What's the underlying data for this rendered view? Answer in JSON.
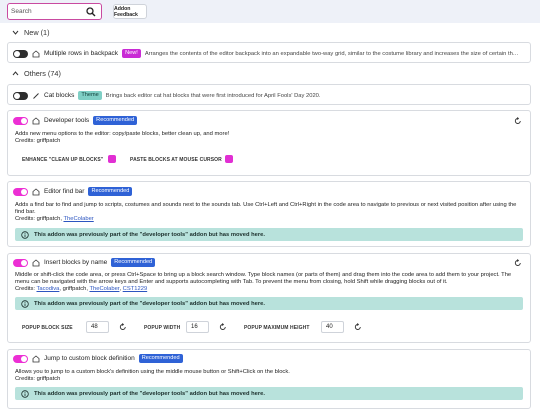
{
  "toolbar": {
    "search_placeholder": "Search",
    "feedback_label": "Addon Feedback"
  },
  "sections": {
    "new_label": "New (1)",
    "others_label": "Others (74)"
  },
  "addons": {
    "backpack": {
      "name": "Multiple rows in backpack",
      "tag": "New!",
      "description": "Arranges the contents of the editor backpack into an expandable two-way grid, similar to the costume library and increases the size of certain thu..."
    },
    "cat_blocks": {
      "name": "Cat blocks",
      "tag": "Theme",
      "description": "Brings back editor cat hat blocks that were first introduced for April Fools' Day 2020."
    },
    "developer_tools": {
      "name": "Developer tools",
      "tag": "Recommended",
      "description": "Adds new menu options to the editor: copy/paste blocks, better clean up, and more!",
      "credits": "Credits: griffpatch",
      "setting1": "ENHANCE \"CLEAN UP BLOCKS\"",
      "setting2": "PASTE BLOCKS AT MOUSE CURSOR"
    },
    "find_bar": {
      "name": "Editor find bar",
      "tag": "Recommended",
      "description": "Adds a find bar to find and jump to scripts, costumes and sounds next to the sounds tab. Use Ctrl+Left and Ctrl+Right in the code area to navigate to previous or next visited position after using the find bar.",
      "credits_prefix": "Credits: griffpatch, ",
      "credit_link": "TheColaber",
      "notice": "This addon was previously part of the \"developer tools\" addon but has moved here."
    },
    "insert_blocks": {
      "name": "Insert blocks by name",
      "tag": "Recommended",
      "description": "Middle or shift-click the code area, or press Ctrl+Space to bring up a block search window. Type block names (or parts of them) and drag them into the code area to add them to your project. The menu can be navigated with the arrow keys and Enter and supports autocompleting with Tab. To prevent the menu from closing, hold Shift while dragging blocks out of it.",
      "credits_prefix": "Credits: ",
      "credit_link1": "Tacodiva",
      "credits_mid": ", griffpatch, ",
      "credit_link2": "TheColaber",
      "credit_sep": ", ",
      "credit_link3": "CST1229",
      "notice": "This addon was previously part of the \"developer tools\" addon but has moved here.",
      "size_label": "POPUP BLOCK SIZE",
      "size_value": "48",
      "width_label": "POPUP WIDTH",
      "width_value": "16",
      "height_label": "POPUP MAXIMUM HEIGHT",
      "height_value": "40"
    },
    "jump_def": {
      "name": "Jump to custom block definition",
      "tag": "Recommended",
      "description": "Allows you to jump to a custom block's definition using the middle mouse button or Shift+Click on the block.",
      "credits": "Credits: griffpatch",
      "notice": "This addon was previously part of the \"developer tools\" addon but has moved here."
    }
  },
  "colors": {
    "accent": "#ec2fd4",
    "recommended": "#2f62d6",
    "notice_bg": "#b8e2dc"
  }
}
